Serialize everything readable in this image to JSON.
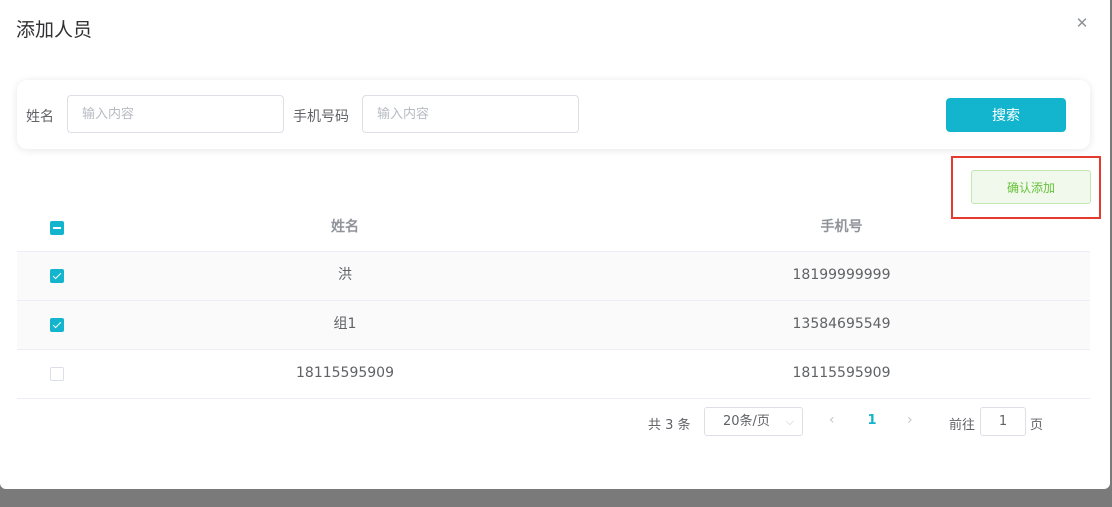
{
  "dialog": {
    "title": "添加人员",
    "close_glyph": "✕"
  },
  "search": {
    "name_label": "姓名",
    "name_placeholder": "输入内容",
    "phone_label": "手机号码",
    "phone_placeholder": "输入内容",
    "search_button": "搜索"
  },
  "actions": {
    "confirm_button": "确认添加"
  },
  "table": {
    "columns": [
      "姓名",
      "手机号"
    ],
    "select_all_state": "indeterminate",
    "rows": [
      {
        "name": "洪",
        "phone": "18199999999",
        "checked": true
      },
      {
        "name": "组1",
        "phone": "13584695549",
        "checked": true
      },
      {
        "name": "18115595909",
        "phone": "18115595909",
        "checked": false
      }
    ]
  },
  "pagination": {
    "total_text": "共 3 条",
    "page_size": "20条/页",
    "prev_glyph": "‹",
    "current_page": "1",
    "next_glyph": "›",
    "goto_label": "前往",
    "goto_value": "1",
    "page_suffix": "页"
  },
  "colors": {
    "accent": "#13b5ce",
    "success_text": "#67c23a",
    "highlight_border": "#e43a2f"
  }
}
